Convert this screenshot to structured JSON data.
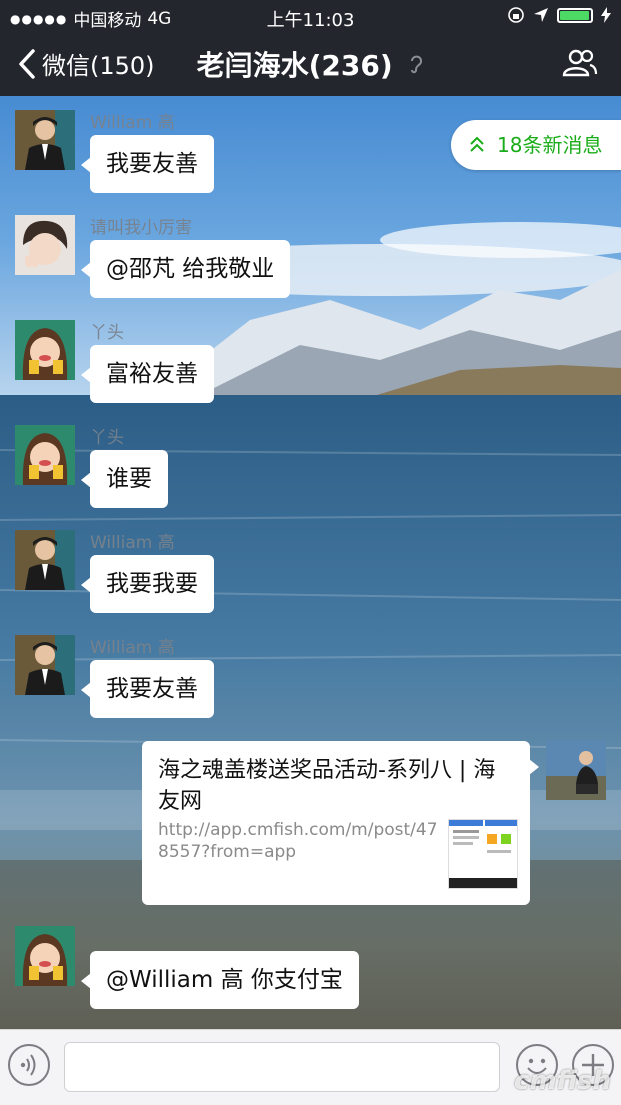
{
  "status_bar": {
    "carrier": "中国移动",
    "network": "4G",
    "time": "上午11:03",
    "battery_level": 0.95
  },
  "nav": {
    "back_label": "微信(150)",
    "title": "老闫海水(236)"
  },
  "new_messages": {
    "label": "18条新消息"
  },
  "messages": [
    {
      "sender": "William 高",
      "text": "我要友善"
    },
    {
      "sender": "请叫我小厉害",
      "text": "@邵芃 给我敬业"
    },
    {
      "sender": "丫头",
      "text": "富裕友善"
    },
    {
      "sender": "丫头",
      "text": "谁要"
    },
    {
      "sender": "William 高",
      "text": "我要我要"
    },
    {
      "sender": "William 高",
      "text": "我要友善"
    },
    {
      "sender": "丫头",
      "text": "@William 高  你支付宝"
    }
  ],
  "link_card": {
    "title": "海之魂盖楼送奖品活动-系列八 | 海友网",
    "url": "http://app.cmfish.com/m/post/478557?from=app"
  },
  "watermark": "cmfish",
  "colors": {
    "accent": "#1aad19",
    "nav_bg": "#23262c",
    "bubble": "#ffffff"
  },
  "icons": [
    "back-chevron-icon",
    "ear-icon",
    "members-icon",
    "double-up-icon",
    "voice-icon",
    "emoji-icon",
    "plus-icon"
  ]
}
